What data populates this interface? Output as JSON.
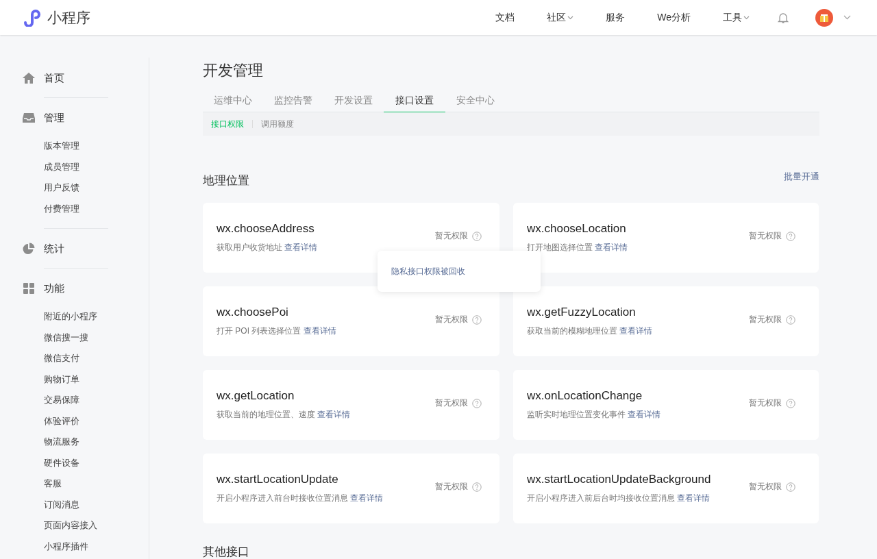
{
  "header": {
    "logo": "小程序",
    "nav": [
      {
        "label": "文档",
        "dropdown": false
      },
      {
        "label": "社区",
        "dropdown": true
      },
      {
        "label": "服务",
        "dropdown": false
      },
      {
        "label": "We分析",
        "dropdown": false
      },
      {
        "label": "工具",
        "dropdown": true
      }
    ]
  },
  "sidebar": {
    "groups": [
      {
        "label": "首页"
      },
      {
        "label": "管理",
        "children": [
          "版本管理",
          "成员管理",
          "用户反馈",
          "付费管理"
        ]
      },
      {
        "label": "统计"
      },
      {
        "label": "功能",
        "children": [
          "附近的小程序",
          "微信搜一搜",
          "微信支付",
          "购物订单",
          "交易保障",
          "体验评价",
          "物流服务",
          "硬件设备",
          "客服",
          "订阅消息",
          "页面内容接入",
          "小程序插件"
        ]
      }
    ]
  },
  "page": {
    "title": "开发管理",
    "tabs": [
      {
        "label": "运维中心",
        "selected": false
      },
      {
        "label": "监控告警",
        "selected": false
      },
      {
        "label": "开发设置",
        "selected": false
      },
      {
        "label": "接口设置",
        "selected": true
      },
      {
        "label": "安全中心",
        "selected": false
      }
    ],
    "subtabs": [
      {
        "label": "接口权限",
        "selected": true
      },
      {
        "label": "调用额度",
        "selected": false
      }
    ],
    "section": {
      "title": "地理位置",
      "action": "批量开通",
      "cards": [
        {
          "name": "wx.chooseAddress",
          "desc": "获取用户收货地址",
          "link": "查看详情",
          "status": "暂无权限",
          "tooltip": "隐私接口权限被回收"
        },
        {
          "name": "wx.chooseLocation",
          "desc": "打开地图选择位置",
          "link": "查看详情",
          "status": "暂无权限"
        },
        {
          "name": "wx.choosePoi",
          "desc": "打开 POI 列表选择位置",
          "link": "查看详情",
          "status": "暂无权限"
        },
        {
          "name": "wx.getFuzzyLocation",
          "desc": "获取当前的模糊地理位置",
          "link": "查看详情",
          "status": "暂无权限"
        },
        {
          "name": "wx.getLocation",
          "desc": "获取当前的地理位置、速度",
          "link": "查看详情",
          "status": "暂无权限"
        },
        {
          "name": "wx.onLocationChange",
          "desc": "监听实时地理位置变化事件",
          "link": "查看详情",
          "status": "暂无权限"
        },
        {
          "name": "wx.startLocationUpdate",
          "desc": "开启小程序进入前台时接收位置消息",
          "link": "查看详情",
          "status": "暂无权限"
        },
        {
          "name": "wx.startLocationUpdateBackground",
          "desc": "开启小程序进入前后台时均接收位置消息",
          "link": "查看详情",
          "status": "暂无权限"
        }
      ]
    },
    "next_section": {
      "title": "其他接口"
    }
  }
}
